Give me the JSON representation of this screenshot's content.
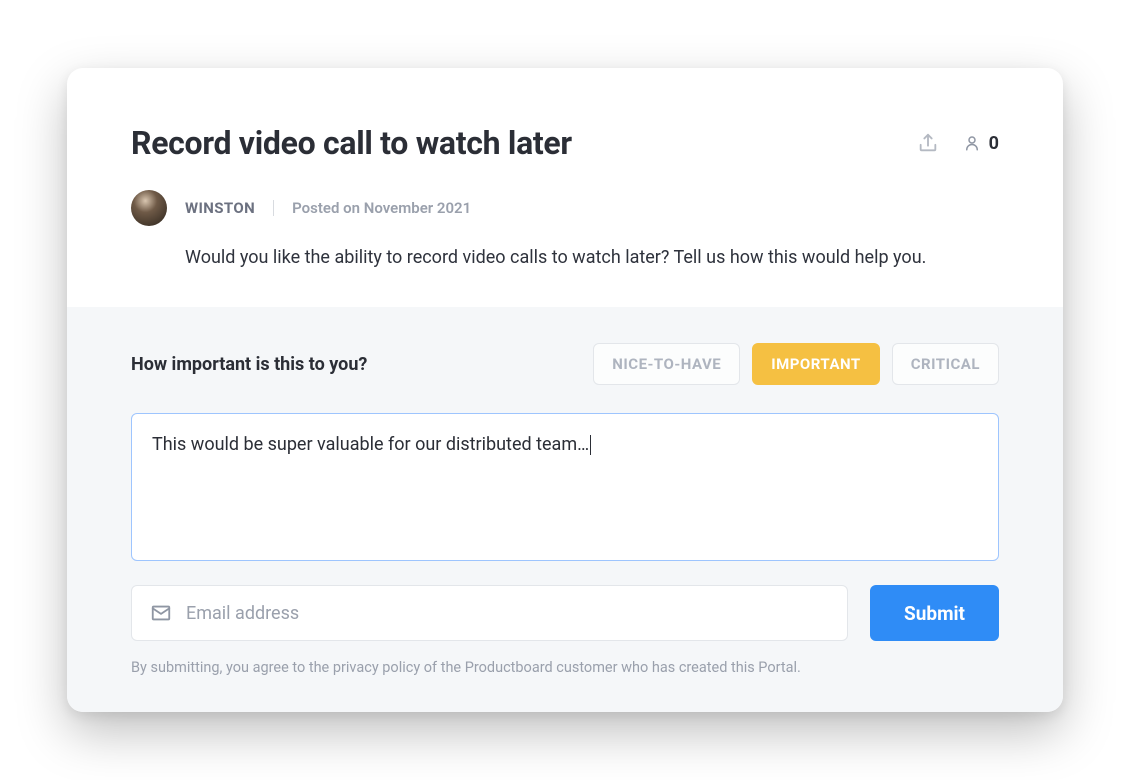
{
  "header": {
    "title": "Record video call to watch later",
    "votes_count": "0",
    "author": "WINSTON",
    "posted_label": "Posted on November 2021",
    "description": "Would you like the ability to record video calls to watch later? Tell us how this would help you."
  },
  "form": {
    "importance_label": "How important is this to you?",
    "options": {
      "nice": "NICE-TO-HAVE",
      "important": "IMPORTANT",
      "critical": "CRITICAL"
    },
    "selected_option": "important",
    "comment_value": "This would be super valuable for our distributed team…",
    "email_placeholder": "Email address",
    "submit_label": "Submit",
    "disclaimer": "By submitting, you agree to the privacy policy of the Productboard customer who has created this Portal."
  },
  "colors": {
    "accent_yellow": "#f5c042",
    "accent_blue": "#2f8cf6",
    "panel_bg": "#f5f7f9"
  }
}
